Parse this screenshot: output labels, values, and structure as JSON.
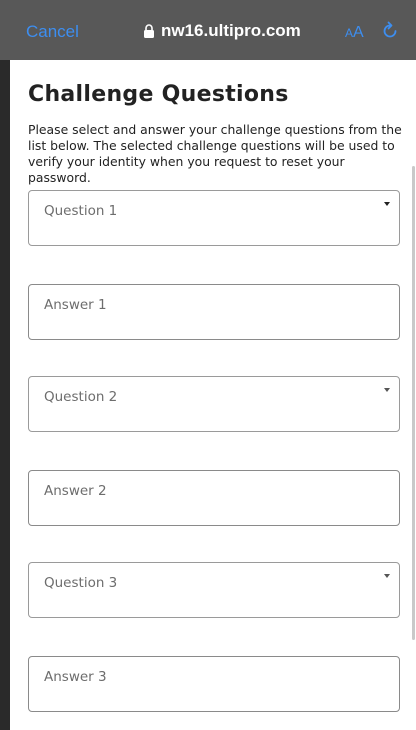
{
  "browser": {
    "cancel_label": "Cancel",
    "url": "nw16.ultipro.com",
    "aa_small": "A",
    "aa_big": "A"
  },
  "page": {
    "title": "Challenge Questions",
    "description": "Please select and answer your challenge questions from the list below. The selected challenge questions will be used to verify your identity when you request to reset your password."
  },
  "fields": {
    "question1": "Question 1",
    "answer1": "Answer 1",
    "question2": "Question 2",
    "answer2": "Answer 2",
    "question3": "Question 3",
    "answer3": "Answer 3"
  },
  "colors": {
    "topbar": "#585858",
    "link_blue": "#3d8ef0"
  },
  "icons": {
    "lock": "lock-icon",
    "reload": "reload-icon",
    "dropdown": "chevron-down-icon"
  }
}
